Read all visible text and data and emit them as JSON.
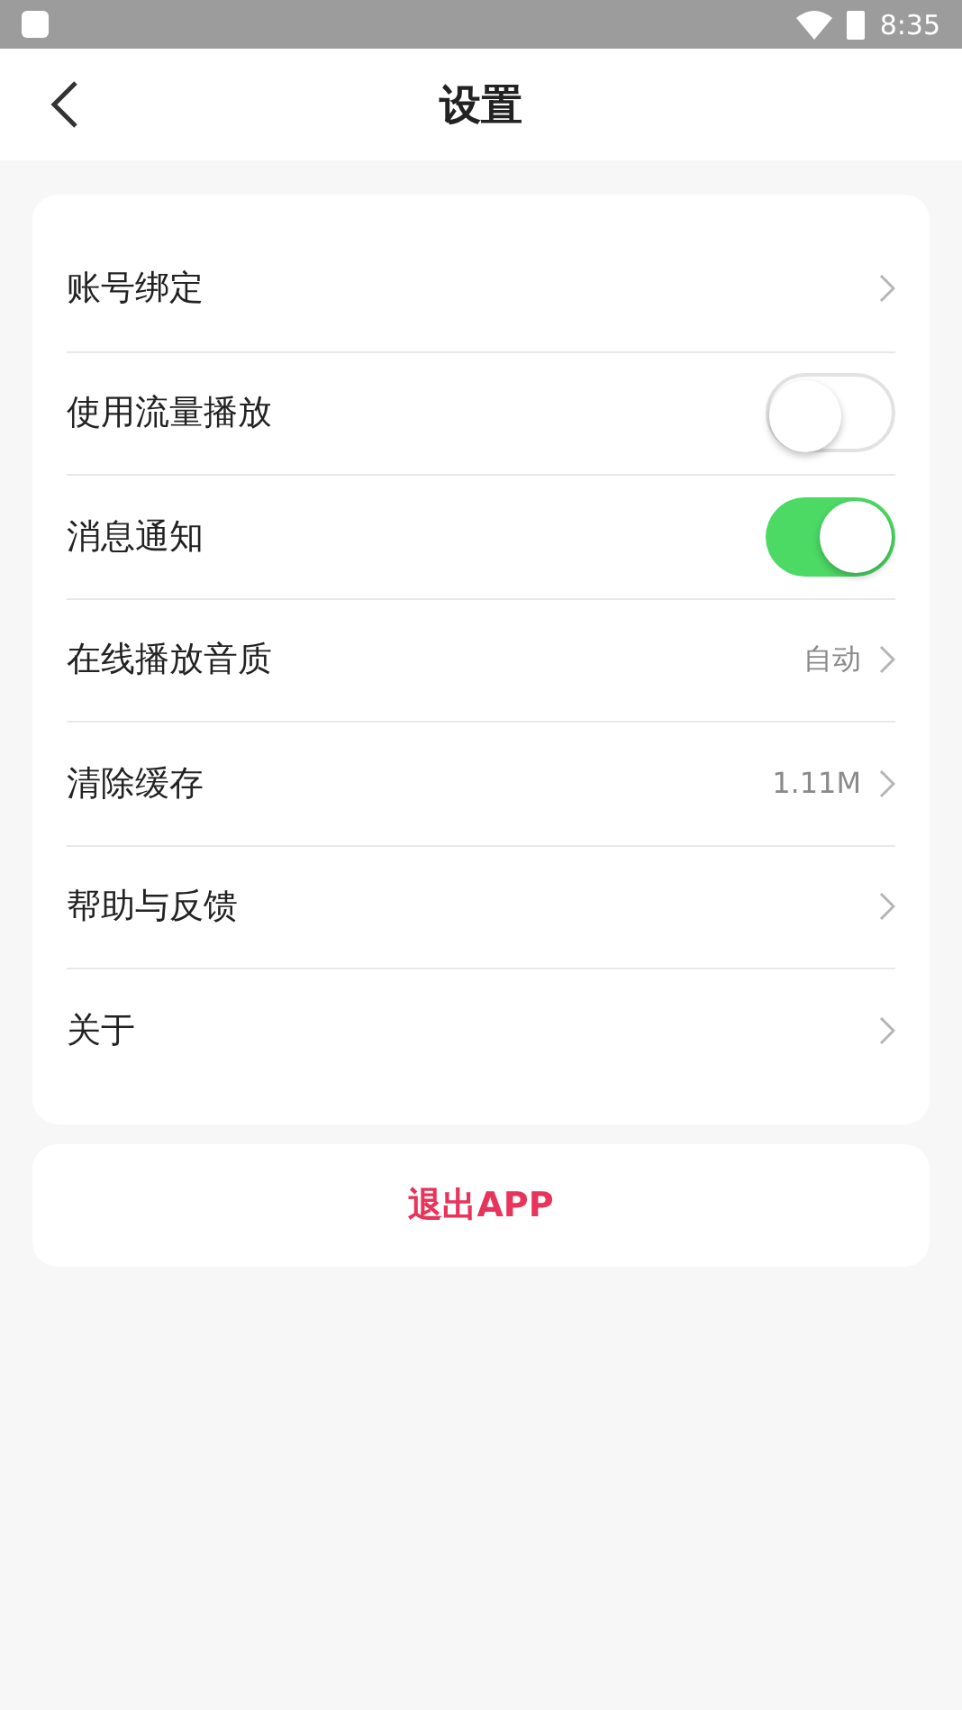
{
  "status_bar": {
    "time": "8:35"
  },
  "header": {
    "title": "设置"
  },
  "settings": [
    {
      "kind": "link",
      "label": "账号绑定"
    },
    {
      "kind": "toggle",
      "label": "使用流量播放",
      "on": false
    },
    {
      "kind": "toggle",
      "label": "消息通知",
      "on": true
    },
    {
      "kind": "link",
      "label": "在线播放音质",
      "value": "自动"
    },
    {
      "kind": "link",
      "label": "清除缓存",
      "value": "1.11M"
    },
    {
      "kind": "link",
      "label": "帮助与反馈"
    },
    {
      "kind": "link",
      "label": "关于"
    }
  ],
  "logout_button": {
    "label": "退出APP"
  }
}
